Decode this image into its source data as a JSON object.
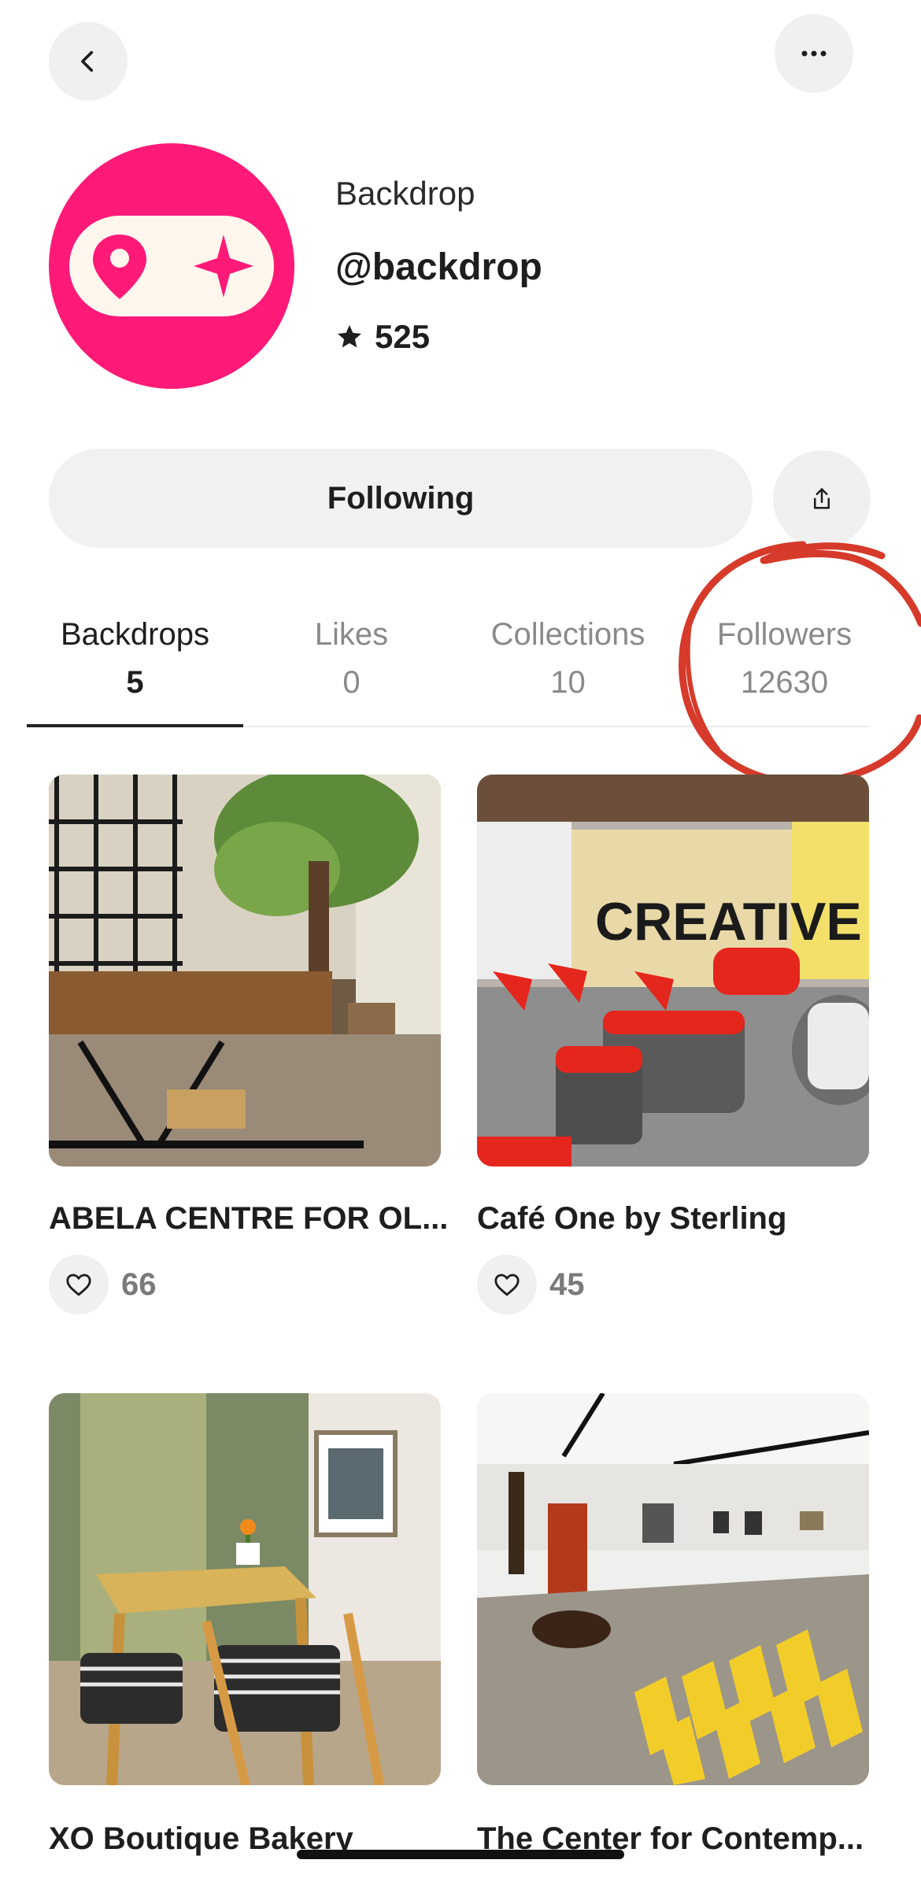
{
  "profile": {
    "display_name": "Backdrop",
    "handle": "@backdrop",
    "rating": "525"
  },
  "actions": {
    "follow_label": "Following"
  },
  "tabs": [
    {
      "label": "Backdrops",
      "count": "5",
      "active": true
    },
    {
      "label": "Likes",
      "count": "0",
      "active": false
    },
    {
      "label": "Collections",
      "count": "10",
      "active": false
    },
    {
      "label": "Followers",
      "count": "12630",
      "active": false
    }
  ],
  "cards": [
    {
      "title": "ABELA CENTRE FOR OL...",
      "likes": "66"
    },
    {
      "title": "Café One by Sterling",
      "likes": "45"
    },
    {
      "title": "XO Boutique Bakery",
      "likes": ""
    },
    {
      "title": "The Center for Contemp...",
      "likes": ""
    }
  ],
  "annotation_color": "#d63a2a",
  "brand_color": "#ff1a78"
}
